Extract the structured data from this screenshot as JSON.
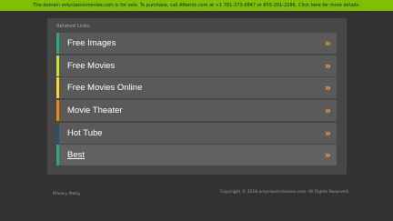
{
  "banner": {
    "text": "The domain onlyclassicmovies.com is for sale. To purchase, call Afternic.com at +1 781-373-6847 or 855-201-2286. Click here for more details."
  },
  "panel": {
    "title": "Related Links",
    "links": [
      {
        "label": "Free Images",
        "accent": "#3aa37c",
        "chevron": "»"
      },
      {
        "label": "Free Movies",
        "accent": "#c6e04a",
        "chevron": "»"
      },
      {
        "label": "Free Movies Online",
        "accent": "#f2d64d",
        "chevron": "»"
      },
      {
        "label": "Movie Theater",
        "accent": "#e08a2a",
        "chevron": "»"
      },
      {
        "label": "Hot Tube",
        "accent": "#2b4f6e",
        "chevron": "»"
      },
      {
        "label": "Best",
        "accent": "#3aa37c",
        "chevron": "»"
      }
    ]
  },
  "footer": {
    "privacy": "Privacy Policy",
    "copyright": "Copyright © 2018 onlyclassicmovies.com. All Rights Reserved."
  },
  "colors": {
    "banner_bg": "#7dc000",
    "page_bg": "#323232",
    "chevron": "#f0a33a"
  }
}
